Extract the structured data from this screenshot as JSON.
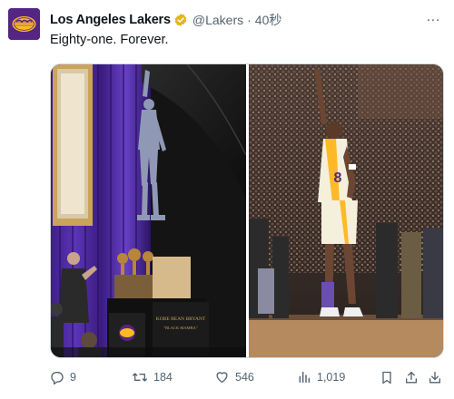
{
  "tweet": {
    "display_name": "Los Angeles Lakers",
    "handle": "@Lakers",
    "separator": "·",
    "time": "40秒",
    "text": "Eighty-one. Forever.",
    "more_label": "…"
  },
  "photos": {
    "statue_plaque_title": "KOBE BEAN BRYANT",
    "statue_plaque_subtitle": "\"BLACK MAMBA\"",
    "jersey_number": "8"
  },
  "actions": {
    "replies": "9",
    "reposts": "184",
    "likes": "546",
    "views": "1,019"
  },
  "colors": {
    "lakers_purple": "#552583",
    "lakers_gold": "#fdb927",
    "verified_gold": "#e2b719",
    "text_secondary": "#536471"
  },
  "icons": [
    "lakers-logo",
    "verified-badge-icon",
    "more-icon",
    "reply-icon",
    "repost-icon",
    "like-icon",
    "views-icon",
    "bookmark-icon",
    "share-icon",
    "download-icon"
  ]
}
